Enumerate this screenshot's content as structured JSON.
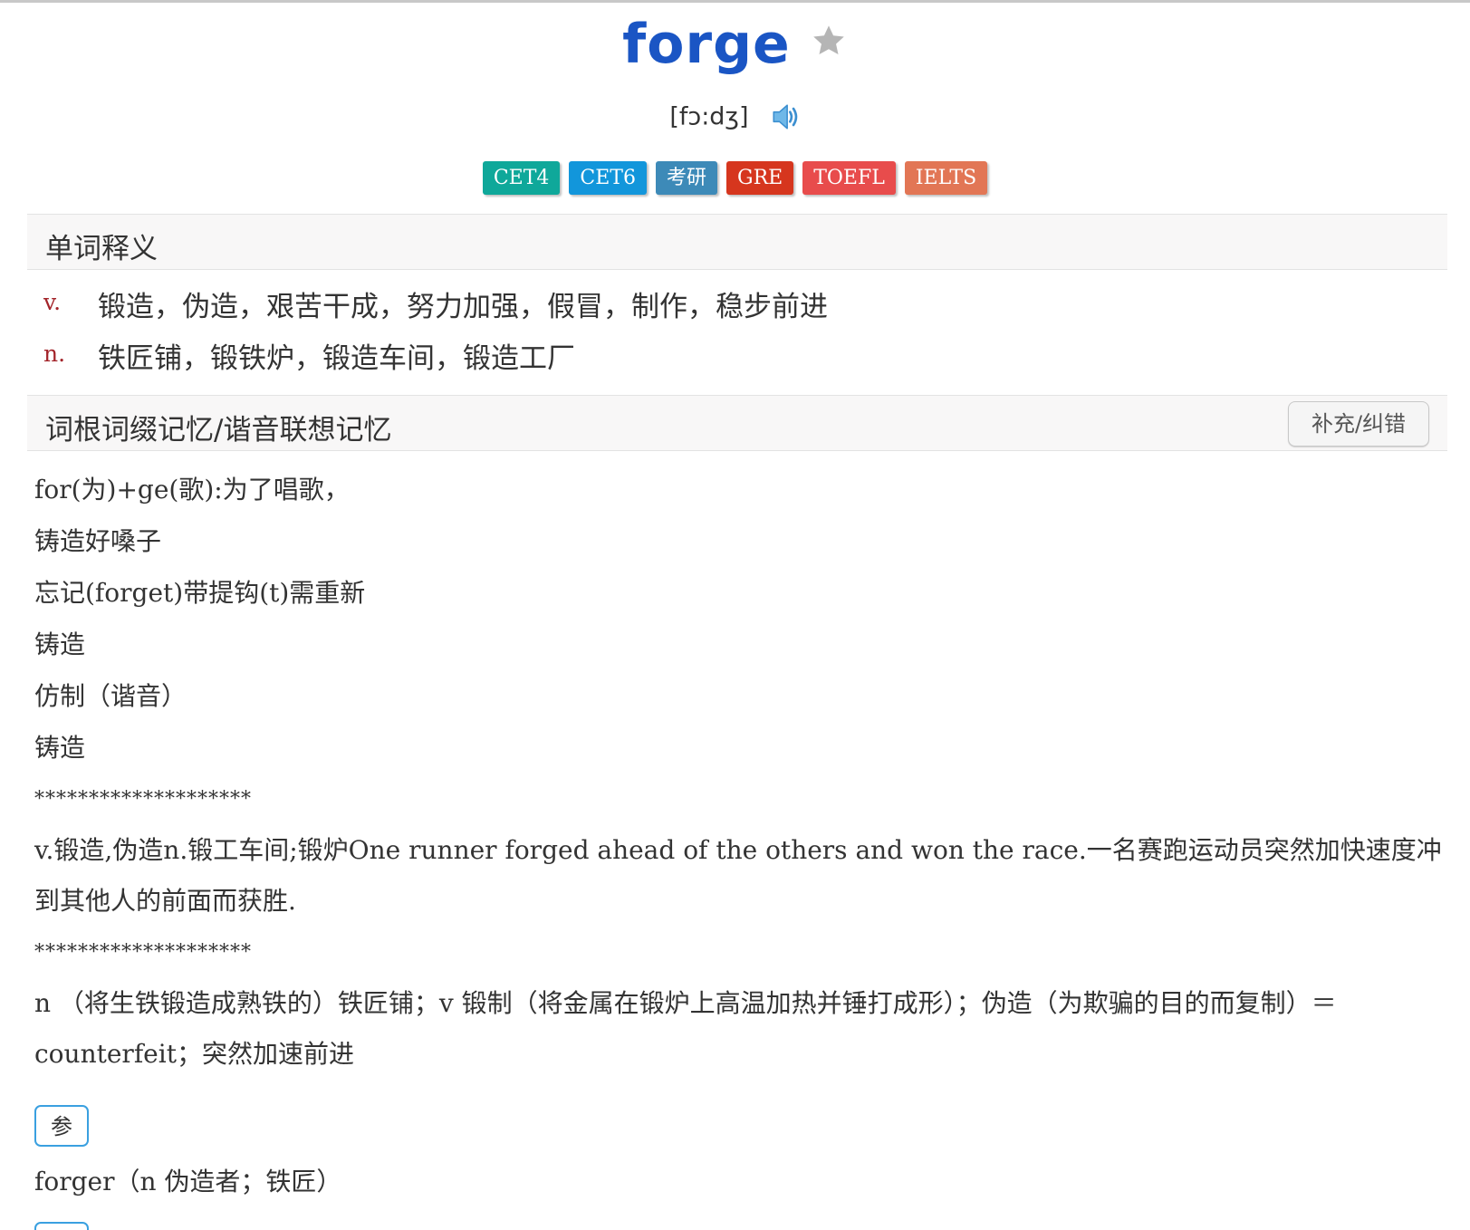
{
  "word": {
    "title": "forge",
    "favorite_icon": "star-icon",
    "phonetic": "[fɔ:dʒ]",
    "audio_icon": "speaker-icon"
  },
  "tags": [
    {
      "label": "CET4",
      "color": "#0fa89a"
    },
    {
      "label": "CET6",
      "color": "#1296db"
    },
    {
      "label": "考研",
      "color": "#3d8ab8"
    },
    {
      "label": "GRE",
      "color": "#d6361e"
    },
    {
      "label": "TOEFL",
      "color": "#e84c4c"
    },
    {
      "label": "IELTS",
      "color": "#e27655"
    }
  ],
  "definitions_section": {
    "title": "单词释义",
    "items": [
      {
        "pos": "v.",
        "meaning": "锻造，伪造，艰苦干成，努力加强，假冒，制作，稳步前进"
      },
      {
        "pos": "n.",
        "meaning": "铁匠铺，锻铁炉，锻造车间，锻造工厂"
      }
    ]
  },
  "memory_section": {
    "title": "词根词缀记忆/谐音联想记忆",
    "correct_button": "补充/纠错",
    "lines": [
      "for(为)+ge(歌):为了唱歌，",
      "铸造好嗓子",
      "忘记(forget)带提钩(t)需重新",
      "铸造",
      "仿制（谐音）",
      "铸造"
    ],
    "separator": "********************",
    "example": "v.锻造,伪造n.锻工车间;锻炉One runner forged ahead of the others and won the race.一名赛跑运动员突然加快速度冲到其他人的前面而获胜.",
    "definition_note": "n （将生铁锻造成熟铁的）铁匠铺；v 锻制（将金属在锻炉上高温加热并锤打成形）；伪造（为欺骗的目的而复制）＝counterfeit；突然加速前进",
    "ref_button": "参",
    "derived": "forger（n 伪造者；铁匠）"
  }
}
